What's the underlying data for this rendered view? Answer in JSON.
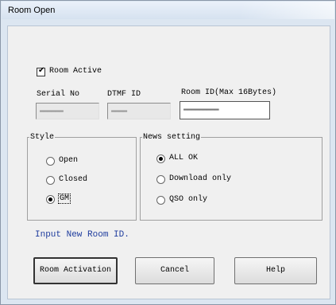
{
  "window": {
    "title": "Room Open"
  },
  "room_active": {
    "label": "Room Active",
    "checked": true
  },
  "fields": {
    "serial_label": "Serial No",
    "serial_value": "▬▬▬▬▬▬",
    "dtmf_label": "DTMF ID",
    "dtmf_value": "▬▬▬▬",
    "room_label": "Room ID(Max 16Bytes)",
    "room_value": "▬▬▬▬▬▬▬▬▬"
  },
  "style": {
    "legend": "Style",
    "options": [
      {
        "label": "Open",
        "selected": false
      },
      {
        "label": "Closed",
        "selected": false
      },
      {
        "label": "GM",
        "selected": true
      }
    ]
  },
  "news": {
    "legend": "News setting",
    "options": [
      {
        "label": "ALL OK",
        "selected": true
      },
      {
        "label": "Download only",
        "selected": false
      },
      {
        "label": "QSO only",
        "selected": false
      }
    ]
  },
  "info_text": "Input New Room ID.",
  "buttons": {
    "activate": "Room Activation",
    "cancel": "Cancel",
    "help": "Help"
  }
}
